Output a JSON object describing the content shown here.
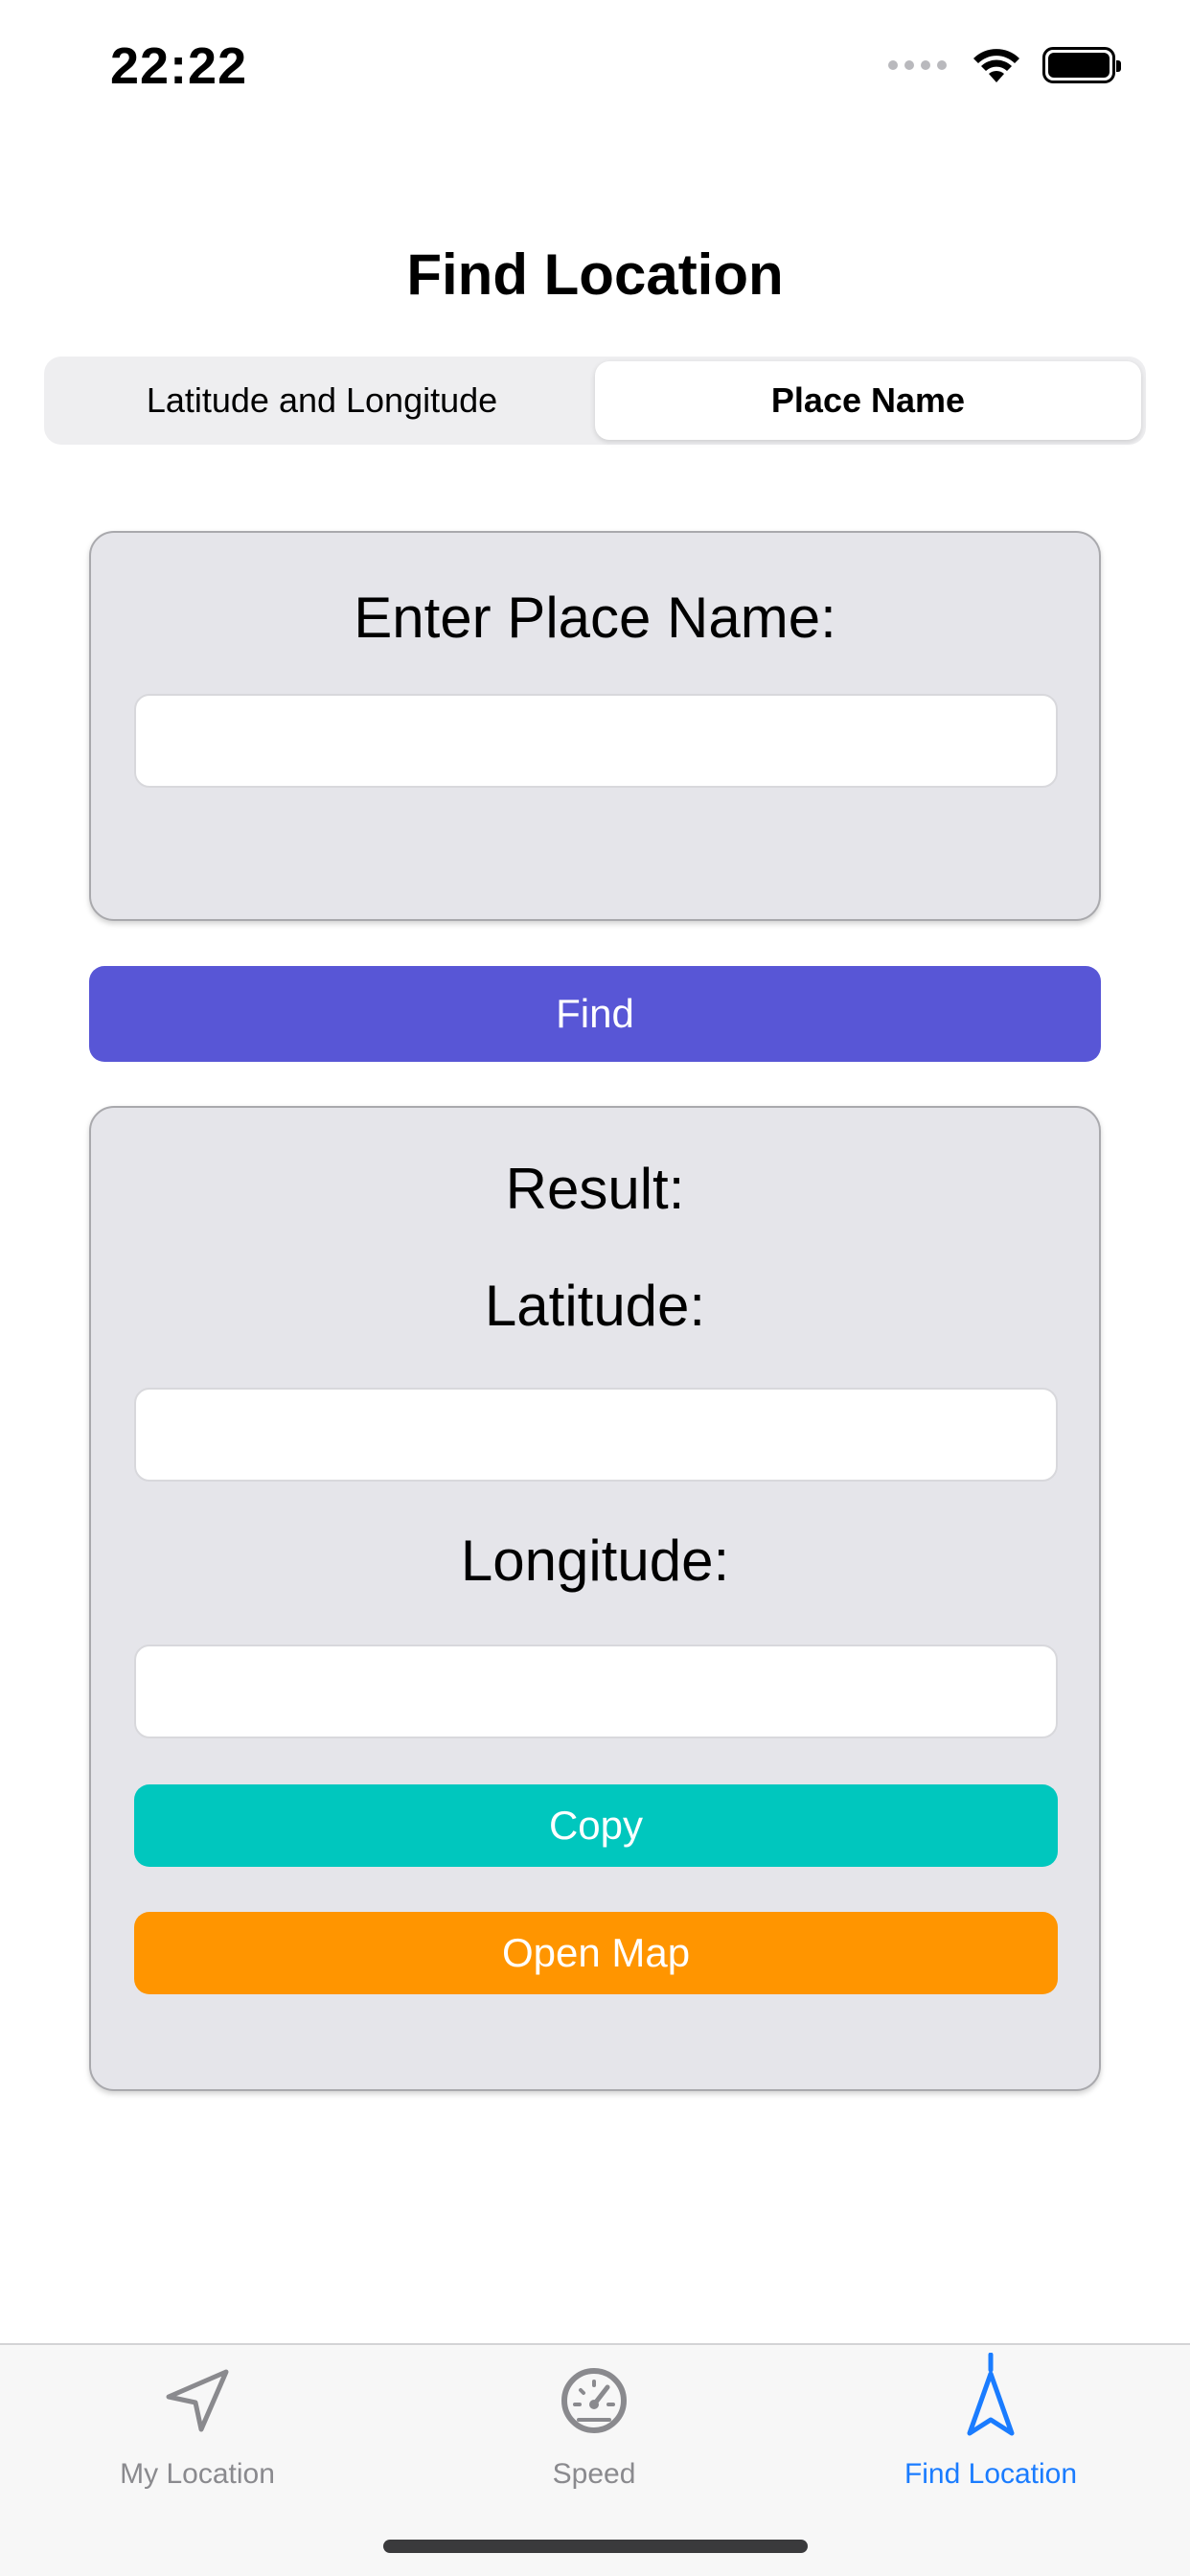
{
  "status_bar": {
    "time": "22:22",
    "icons": [
      "signal-dots-icon",
      "wifi-icon",
      "battery-icon"
    ]
  },
  "page": {
    "title": "Find Location"
  },
  "segmented_control": {
    "segments": [
      {
        "label": "Latitude and Longitude",
        "active": false
      },
      {
        "label": "Place Name",
        "active": true
      }
    ]
  },
  "input_card": {
    "heading": "Enter Place Name:",
    "place_input": {
      "value": "",
      "placeholder": ""
    }
  },
  "find_button": {
    "label": "Find",
    "color": "#5856d6"
  },
  "result_card": {
    "heading": "Result:",
    "latitude_label": "Latitude:",
    "latitude_value": "",
    "longitude_label": "Longitude:",
    "longitude_value": "",
    "copy_label": "Copy",
    "copy_color": "#00c7be",
    "open_map_label": "Open Map",
    "open_map_color": "#ff9500"
  },
  "tab_bar": {
    "active_color": "#1a7cff",
    "inactive_color": "#8a8a8e",
    "items": [
      {
        "label": "My Location",
        "icon": "location-arrow-icon",
        "active": false
      },
      {
        "label": "Speed",
        "icon": "speedometer-icon",
        "active": false
      },
      {
        "label": "Find Location",
        "icon": "navigation-pointer-icon",
        "active": true
      }
    ]
  }
}
